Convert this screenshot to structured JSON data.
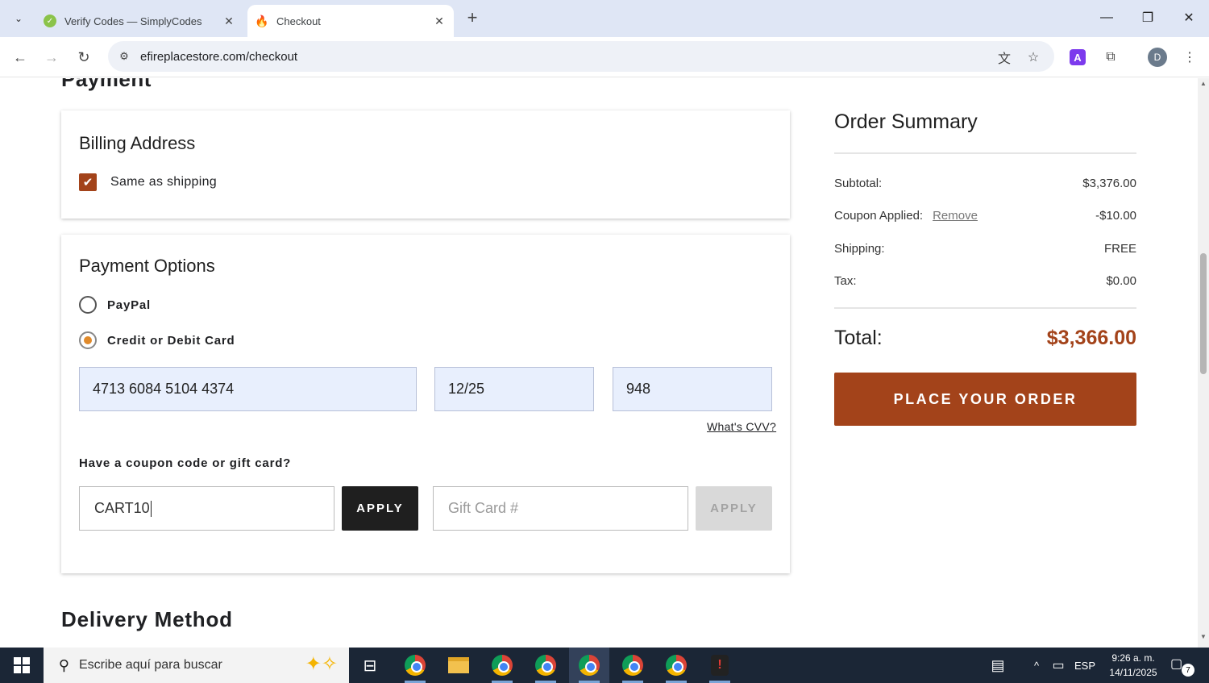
{
  "browser": {
    "tabs": [
      {
        "title": "Verify Codes — SimplyCodes",
        "active": false
      },
      {
        "title": "Checkout",
        "active": true
      }
    ],
    "url": "efireplacestore.com/checkout",
    "profile_initial": "D",
    "extension_letter": "A"
  },
  "page": {
    "payment_heading": "Payment",
    "billing": {
      "title": "Billing Address",
      "same_as_shipping_label": "Same as shipping",
      "same_as_shipping_checked": true
    },
    "payment_options": {
      "title": "Payment Options",
      "options": [
        {
          "label": "PayPal",
          "selected": false
        },
        {
          "label": "Credit or Debit Card",
          "selected": true
        }
      ],
      "card_number": "4713 6084 5104 4374",
      "expiry": "12/25",
      "cvv": "948",
      "cvv_link": "What's CVV?",
      "coupon_question": "Have a coupon code or gift card?",
      "coupon_value": "CART10",
      "apply_label": "APPLY",
      "gift_card_placeholder": "Gift Card #",
      "gift_apply_label": "APPLY"
    },
    "delivery_heading": "Delivery Method"
  },
  "summary": {
    "title": "Order Summary",
    "subtotal_label": "Subtotal:",
    "subtotal_value": "$3,376.00",
    "coupon_label": "Coupon Applied:",
    "coupon_remove": "Remove",
    "coupon_value": "-$10.00",
    "shipping_label": "Shipping:",
    "shipping_value": "FREE",
    "tax_label": "Tax:",
    "tax_value": "$0.00",
    "total_label": "Total:",
    "total_value": "$3,366.00",
    "place_order": "PLACE YOUR ORDER",
    "accent_color": "#a3431a"
  },
  "taskbar": {
    "search_placeholder": "Escribe aquí para buscar",
    "language": "ESP",
    "time": "9:26 a. m.",
    "date": "14/11/2025",
    "notification_count": "7"
  }
}
